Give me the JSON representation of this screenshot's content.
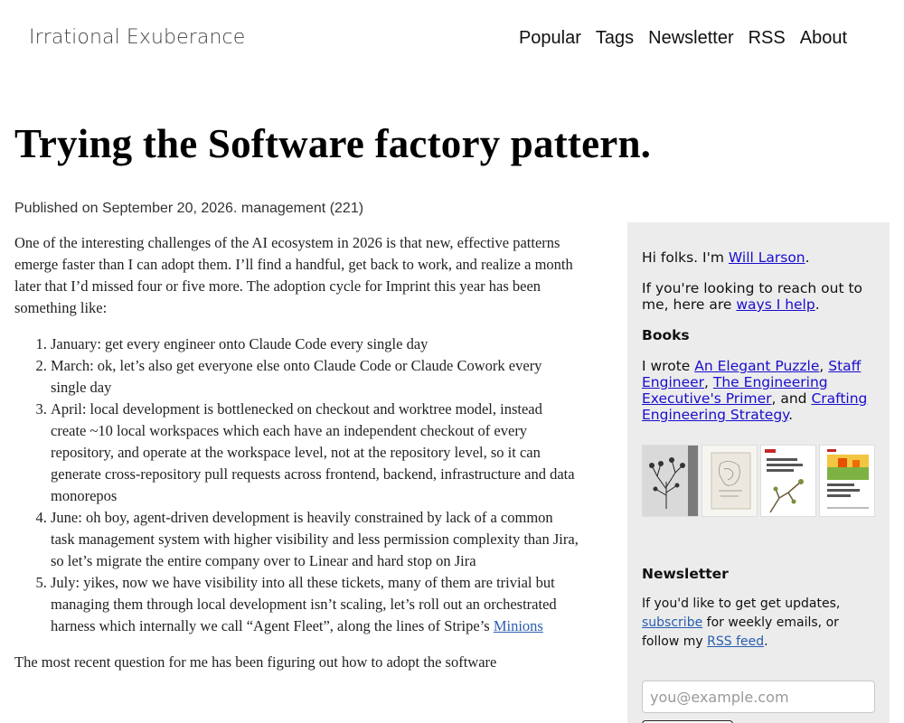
{
  "header": {
    "site_title": "Irrational Exuberance",
    "nav": [
      "Popular",
      "Tags",
      "Newsletter",
      "RSS",
      "About"
    ]
  },
  "post": {
    "title": "Trying the Software factory pattern.",
    "byline_prefix": "Published on September 20, 2026.",
    "tag": "management (221)",
    "intro": "One of the interesting challenges of the AI ecosystem in 2026 is that new, effective patterns emerge faster than I can adopt them. I’ll find a handful, get back to work, and realize a month later that I’d missed four or five more. The adoption cycle for Imprint this year has been something like:",
    "list": [
      "January: get every engineer onto Claude Code every single day",
      "March: ok, let’s also get everyone else onto Claude Code or Claude Cowork every single day",
      "April: local development is bottlenecked on checkout and worktree model, instead create ~10 local workspaces which each have an independent checkout of every repository, and operate at the workspace level, not at the repository level, so it can generate cross-repository pull requests across frontend, backend, infrastructure and data monorepos",
      "June: oh boy, agent-driven development is heavily constrained by lack of a common task management system with higher visibility and less permission complexity than Jira, so let’s migrate the entire company over to Linear and hard stop on Jira",
      "July: yikes, now we have visibility into all these tickets, many of them are trivial but managing them through local development isn’t scaling, let’s roll out an orchestrated harness which internally we call “Agent Fleet”, along the lines of Stripe’s"
    ],
    "list_last_link": "Minions",
    "outro": "The most recent question for me has been figuring out how to adopt the software"
  },
  "sidebar": {
    "greeting_prefix": "Hi folks. I'm ",
    "author_link": "Will Larson",
    "greeting_suffix": ".",
    "reach_prefix": "If you're looking to reach out to me, here are ",
    "reach_link": "ways I help",
    "reach_suffix": ".",
    "books_heading": "Books",
    "books_prefix": "I wrote ",
    "book1": "An Elegant Puzzle",
    "sep1": ", ",
    "book2": "Staff Engineer",
    "sep2": ", ",
    "book3": "The Engineering Executive's Primer",
    "sep3": ", and ",
    "book4": "Crafting Engineering Strategy",
    "books_suffix": ".",
    "newsletter_heading": "Newsletter",
    "newsletter_prefix": "If you'd like to get get updates, ",
    "subscribe_link": "subscribe",
    "newsletter_mid": " for weekly emails, or follow my ",
    "rss_link": "RSS feed",
    "newsletter_suffix": ".",
    "email_placeholder": "you@example.com"
  }
}
